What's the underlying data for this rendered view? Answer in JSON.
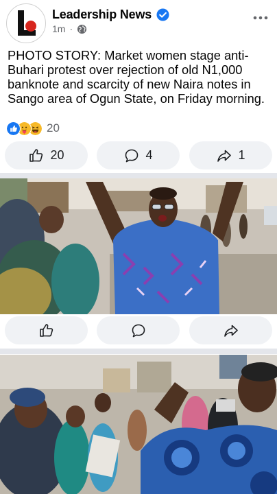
{
  "post": {
    "page_name": "Leadership News",
    "time": "1m",
    "text": "PHOTO STORY: Market women stage anti-Buhari protest over rejection of old N1,000 banknote and scarcity of new Naira notes in Sango area of Ogun State, on Friday morning.",
    "reaction_count": "20",
    "like_count": "20",
    "comment_count": "4",
    "share_count": "1"
  },
  "icons": {
    "verified": "verified-badge-icon",
    "audience": "globe-icon",
    "more": "more-options-icon",
    "like": "thumbs-up-icon",
    "comment": "comment-bubble-icon",
    "share": "share-arrow-icon"
  },
  "reactions": [
    "like",
    "care",
    "haha"
  ],
  "colors": {
    "brand_blue": "#1877f2",
    "logo_red": "#d7261e",
    "button_bg": "#f0f2f5",
    "secondary_text": "#65676b"
  }
}
